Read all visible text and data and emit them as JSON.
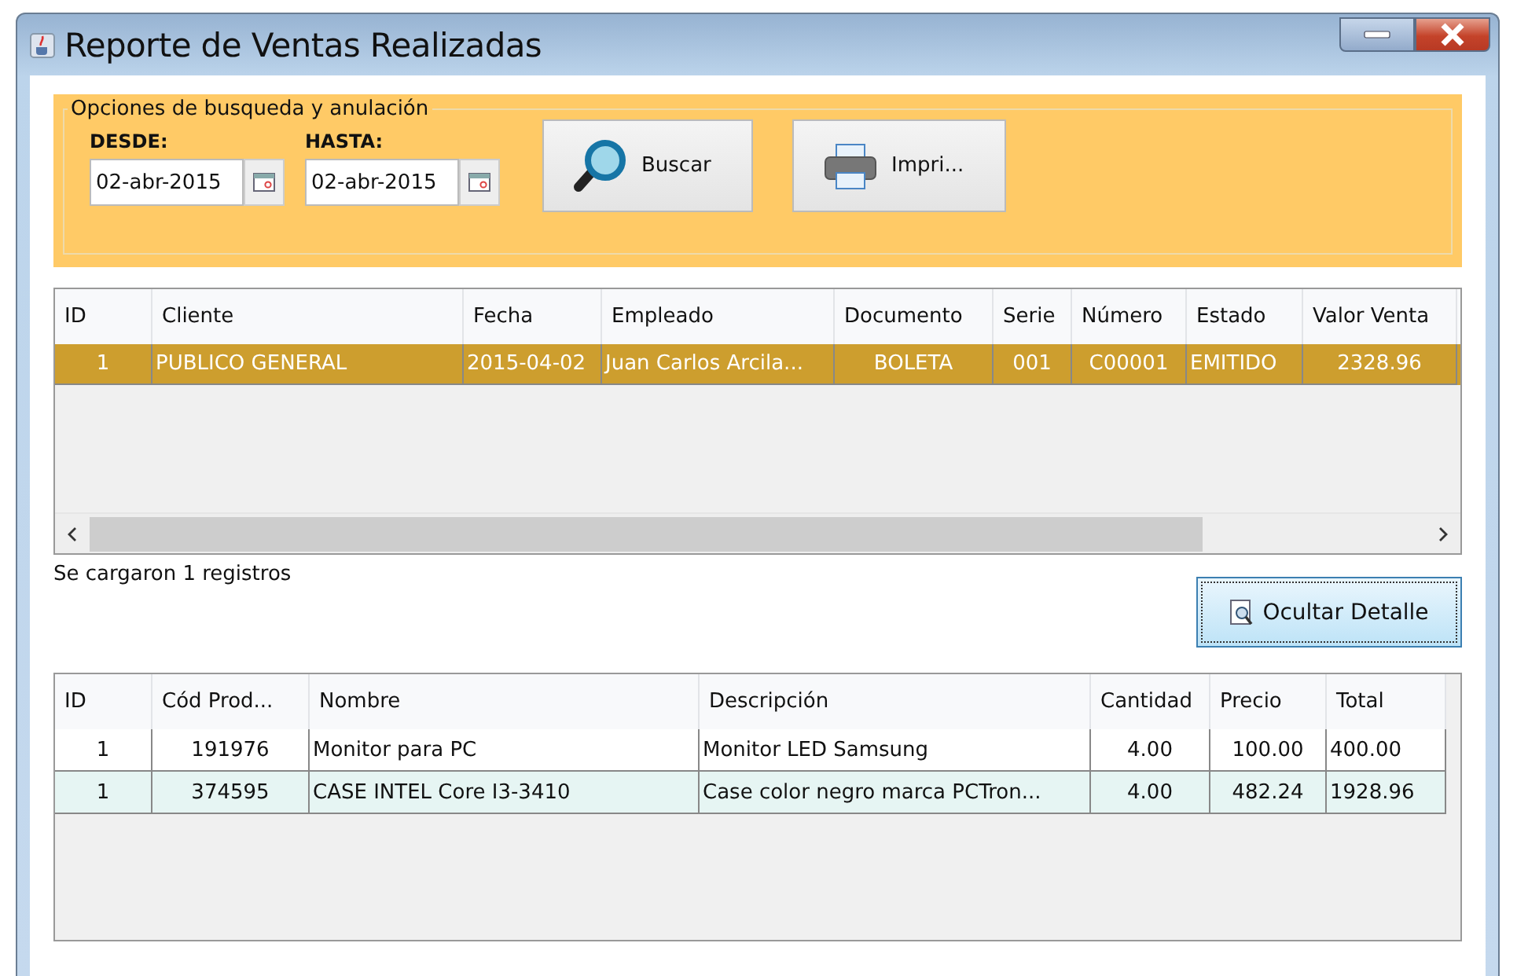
{
  "window": {
    "title": "Reporte de Ventas Realizadas"
  },
  "search_panel": {
    "title": "Opciones de busqueda y anulación",
    "fields": [
      {
        "label": "DESDE:",
        "value": "02-abr-2015"
      },
      {
        "label": "HASTA:",
        "value": "02-abr-2015"
      }
    ],
    "buttons": [
      {
        "kind": "search",
        "label": "Buscar"
      },
      {
        "kind": "print",
        "label": "Impri..."
      }
    ]
  },
  "sales_table": {
    "columns": [
      "ID",
      "Cliente",
      "Fecha",
      "Empleado",
      "Documento",
      "Serie",
      "Número",
      "Estado",
      "Valor Venta"
    ],
    "rows": [
      {
        "selected": true,
        "cells": [
          "1",
          "PUBLICO GENERAL",
          "2015-04-02",
          "Juan Carlos Arcila...",
          "BOLETA",
          "001",
          "C00001",
          "EMITIDO",
          "2328.96"
        ]
      }
    ]
  },
  "status": "Se cargaron 1 registros",
  "detail_button": "Ocultar Detalle",
  "detail_table": {
    "columns": [
      "ID",
      "Cód Prod...",
      "Nombre",
      "Descripción",
      "Cantidad",
      "Precio",
      "Total"
    ],
    "rows": [
      {
        "cells": [
          "1",
          "191976",
          "Monitor para PC",
          "Monitor LED Samsung",
          "4.00",
          "100.00",
          "400.00"
        ]
      },
      {
        "cells": [
          "1",
          "374595",
          "CASE INTEL Core I3-3410",
          "Case color negro marca PCTron...",
          "4.00",
          "482.24",
          "1928.96"
        ]
      }
    ]
  }
}
